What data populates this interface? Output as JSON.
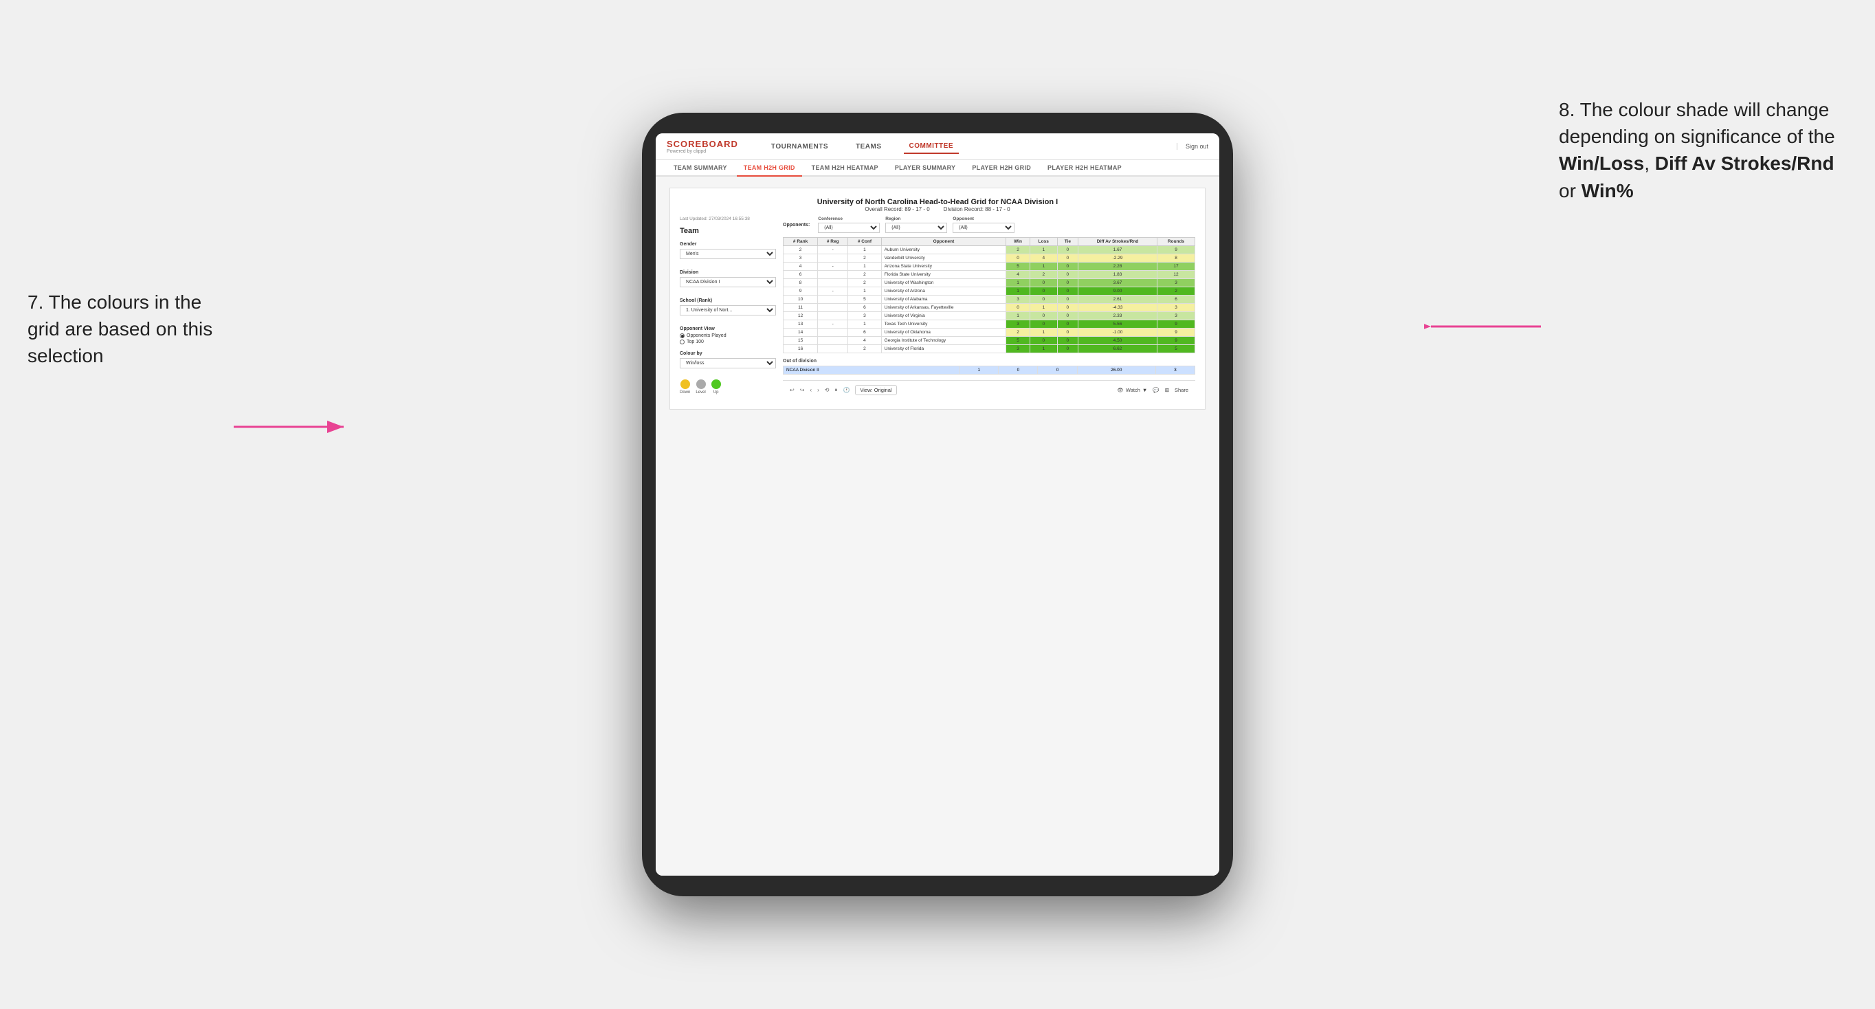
{
  "annotations": {
    "left_title": "7. The colours in the grid are based on this selection",
    "right_title_1": "8. The colour shade will change depending on significance of the ",
    "right_bold_1": "Win/Loss",
    "right_title_2": ", ",
    "right_bold_2": "Diff Av Strokes/Rnd",
    "right_title_3": " or ",
    "right_bold_3": "Win%"
  },
  "nav": {
    "logo": "SCOREBOARD",
    "logo_sub": "Powered by clippd",
    "items": [
      "TOURNAMENTS",
      "TEAMS",
      "COMMITTEE"
    ],
    "sign_out": "Sign out"
  },
  "sub_nav": {
    "items": [
      "TEAM SUMMARY",
      "TEAM H2H GRID",
      "TEAM H2H HEATMAP",
      "PLAYER SUMMARY",
      "PLAYER H2H GRID",
      "PLAYER H2H HEATMAP"
    ]
  },
  "tableau": {
    "timestamp": "Last Updated: 27/03/2024 16:55:38",
    "title": "University of North Carolina Head-to-Head Grid for NCAA Division I",
    "overall_record": "Overall Record: 89 - 17 - 0",
    "division_record": "Division Record: 88 - 17 - 0",
    "left_panel": {
      "team_label": "Team",
      "gender_label": "Gender",
      "gender_value": "Men's",
      "division_label": "Division",
      "division_value": "NCAA Division I",
      "school_label": "School (Rank)",
      "school_value": "1. University of Nort...",
      "opponent_view_label": "Opponent View",
      "radio_options": [
        "Opponents Played",
        "Top 100"
      ],
      "colour_by_label": "Colour by",
      "colour_by_value": "Win/loss",
      "legend": [
        {
          "label": "Down",
          "color": "#f0c020"
        },
        {
          "label": "Level",
          "color": "#aaaaaa"
        },
        {
          "label": "Up",
          "color": "#50c820"
        }
      ]
    },
    "filters": {
      "opponents_label": "Opponents:",
      "conference_label": "Conference",
      "conference_value": "(All)",
      "region_label": "Region",
      "region_value": "(All)",
      "opponent_label": "Opponent",
      "opponent_value": "(All)"
    },
    "table_headers": [
      "# Rank",
      "# Reg",
      "# Conf",
      "Opponent",
      "Win",
      "Loss",
      "Tie",
      "Diff Av Strokes/Rnd",
      "Rounds"
    ],
    "rows": [
      {
        "rank": "2",
        "reg": "-",
        "conf": "1",
        "opponent": "Auburn University",
        "win": "2",
        "loss": "1",
        "tie": "0",
        "diff": "1.67",
        "rounds": "9",
        "color": "green-light"
      },
      {
        "rank": "3",
        "reg": "",
        "conf": "2",
        "opponent": "Vanderbilt University",
        "win": "0",
        "loss": "4",
        "tie": "0",
        "diff": "-2.29",
        "rounds": "8",
        "color": "yellow"
      },
      {
        "rank": "4",
        "reg": "-",
        "conf": "1",
        "opponent": "Arizona State University",
        "win": "5",
        "loss": "1",
        "tie": "0",
        "diff": "2.28",
        "rounds": "17",
        "color": "green-med"
      },
      {
        "rank": "6",
        "reg": "",
        "conf": "2",
        "opponent": "Florida State University",
        "win": "4",
        "loss": "2",
        "tie": "0",
        "diff": "1.83",
        "rounds": "12",
        "color": "green-light"
      },
      {
        "rank": "8",
        "reg": "",
        "conf": "2",
        "opponent": "University of Washington",
        "win": "1",
        "loss": "0",
        "tie": "0",
        "diff": "3.67",
        "rounds": "3",
        "color": "green-med"
      },
      {
        "rank": "9",
        "reg": "-",
        "conf": "1",
        "opponent": "University of Arizona",
        "win": "1",
        "loss": "0",
        "tie": "0",
        "diff": "9.00",
        "rounds": "2",
        "color": "green-dark"
      },
      {
        "rank": "10",
        "reg": "",
        "conf": "5",
        "opponent": "University of Alabama",
        "win": "3",
        "loss": "0",
        "tie": "0",
        "diff": "2.61",
        "rounds": "6",
        "color": "green-light"
      },
      {
        "rank": "11",
        "reg": "",
        "conf": "6",
        "opponent": "University of Arkansas, Fayetteville",
        "win": "0",
        "loss": "1",
        "tie": "0",
        "diff": "-4.33",
        "rounds": "3",
        "color": "yellow"
      },
      {
        "rank": "12",
        "reg": "",
        "conf": "3",
        "opponent": "University of Virginia",
        "win": "1",
        "loss": "0",
        "tie": "0",
        "diff": "2.33",
        "rounds": "3",
        "color": "green-light"
      },
      {
        "rank": "13",
        "reg": "-",
        "conf": "1",
        "opponent": "Texas Tech University",
        "win": "3",
        "loss": "0",
        "tie": "0",
        "diff": "5.56",
        "rounds": "9",
        "color": "green-dark"
      },
      {
        "rank": "14",
        "reg": "",
        "conf": "6",
        "opponent": "University of Oklahoma",
        "win": "2",
        "loss": "1",
        "tie": "0",
        "diff": "-1.00",
        "rounds": "9",
        "color": "yellow"
      },
      {
        "rank": "15",
        "reg": "",
        "conf": "4",
        "opponent": "Georgia Institute of Technology",
        "win": "5",
        "loss": "0",
        "tie": "0",
        "diff": "4.50",
        "rounds": "9",
        "color": "green-dark"
      },
      {
        "rank": "16",
        "reg": "",
        "conf": "2",
        "opponent": "University of Florida",
        "win": "3",
        "loss": "1",
        "tie": "0",
        "diff": "6.62",
        "rounds": "5",
        "color": "green-dark"
      }
    ],
    "out_of_division": {
      "label": "Out of division",
      "rows": [
        {
          "division": "NCAA Division II",
          "win": "1",
          "loss": "0",
          "tie": "0",
          "diff": "26.00",
          "rounds": "3",
          "color": "blue"
        }
      ]
    },
    "toolbar": {
      "view_label": "View: Original",
      "watch_label": "Watch",
      "share_label": "Share"
    }
  }
}
